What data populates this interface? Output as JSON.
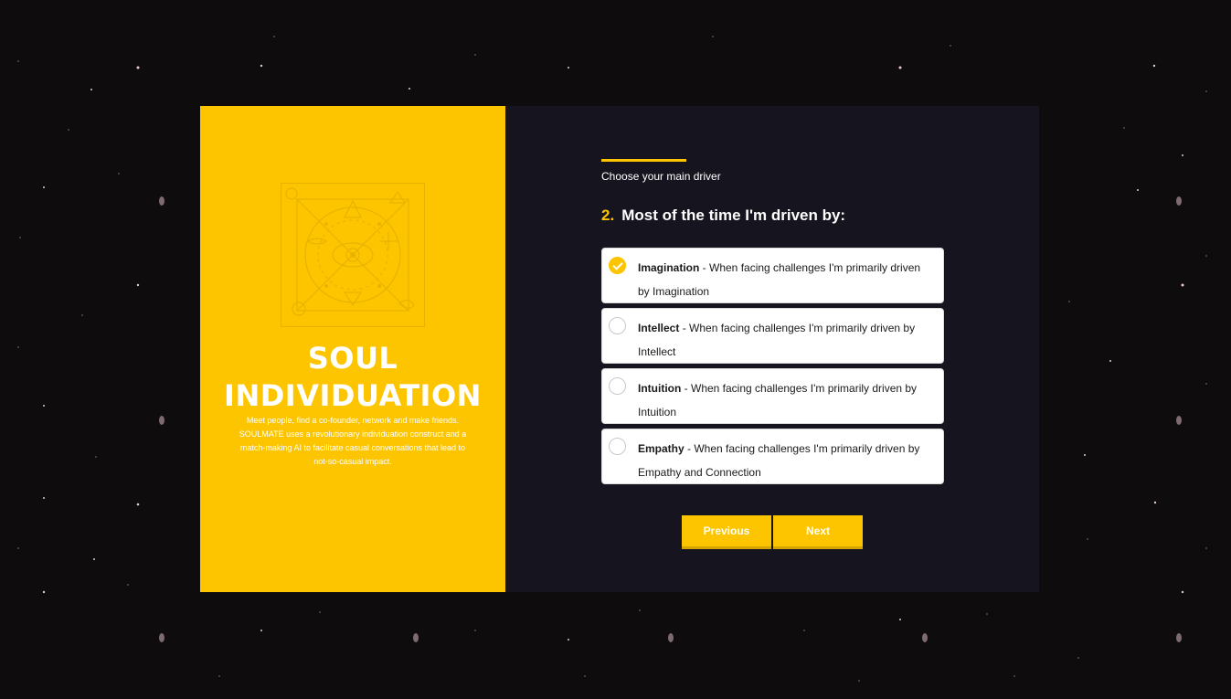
{
  "brand": {
    "title": "SOUL INDIVIDUATION",
    "description": "Meet people, find a co-founder, network and make friends. SOULMATE uses a revolutionary individuation construct and a match-making AI to facilitate casual conversations that lead to not-so-casual impact."
  },
  "form": {
    "step_label": "Choose your main driver",
    "question_number": "2.",
    "question_text": "Most of the time I'm driven by:",
    "options": [
      {
        "name": "Imagination",
        "desc": " - When facing challenges I'm primarily driven by Imagination",
        "checked": true
      },
      {
        "name": "Intellect",
        "desc": " - When facing challenges I'm primarily driven by Intellect",
        "checked": false
      },
      {
        "name": "Intuition",
        "desc": " - When facing challenges I'm primarily driven by Intuition",
        "checked": false
      },
      {
        "name": "Empathy",
        "desc": " - When facing challenges I'm primarily driven by Empathy and Connection",
        "checked": false
      }
    ],
    "previous_label": "Previous",
    "next_label": "Next"
  },
  "colors": {
    "accent": "#fdc500",
    "panel_dark": "#16151f",
    "background": "#0e0c0d"
  }
}
